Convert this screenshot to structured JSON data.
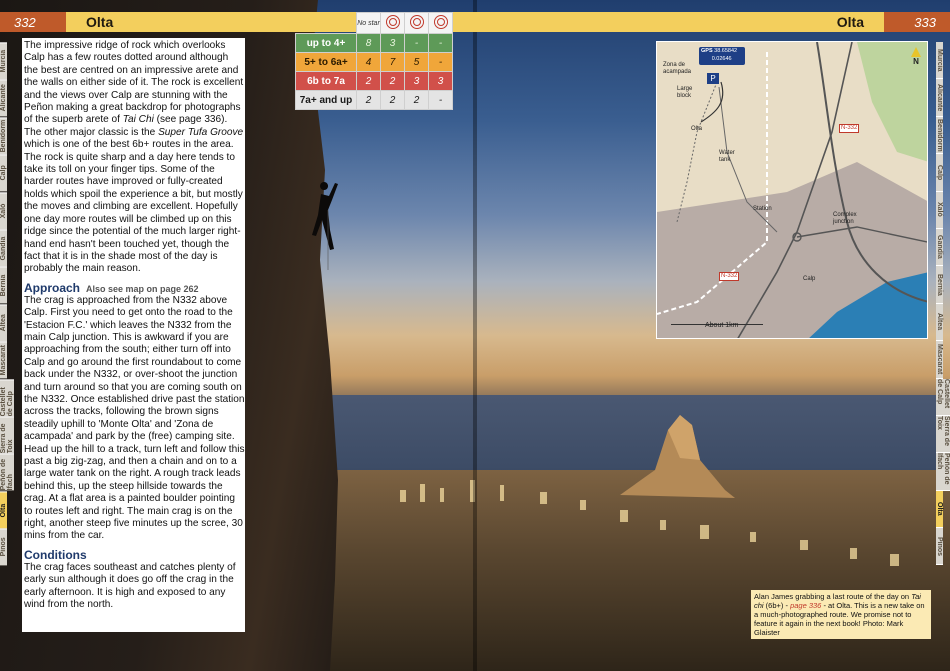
{
  "header": {
    "left_page_number": "332",
    "left_title": "Olta",
    "right_title": "Olta",
    "right_page_number": "333"
  },
  "grade_table": {
    "headers": [
      "No star"
    ],
    "star_icons": [
      "one-star-icon",
      "two-star-icon",
      "three-star-icon"
    ],
    "rows": [
      {
        "label": "up to 4+",
        "values": [
          "8",
          "3",
          "-",
          "-"
        ]
      },
      {
        "label": "5+ to 6a+",
        "values": [
          "4",
          "7",
          "5",
          "-"
        ]
      },
      {
        "label": "6b to 7a",
        "values": [
          "2",
          "2",
          "3",
          "3"
        ]
      },
      {
        "label": "7a+ and up",
        "values": [
          "2",
          "2",
          "2",
          "-"
        ]
      }
    ]
  },
  "tabs_left": [
    "Murcia",
    "Alicante",
    "Benidorm",
    "Calp",
    "Xaló",
    "Gandia",
    "Bernia",
    "Altea",
    "Mascarat",
    "Castellet de Calp",
    "Sierra de Toix",
    "Peñón de Ifach",
    "Olta",
    "Pinos"
  ],
  "tabs_right": [
    "Murcia",
    "Alicante",
    "Benidorm",
    "Calp",
    "Xaló",
    "Gandia",
    "Bernia",
    "Altea",
    "Mascarat",
    "Castellet de Calp",
    "Sierra de Toix",
    "Peñón de Ifach",
    "Olta",
    "Pinos"
  ],
  "active_tab": "Olta",
  "text": {
    "intro_1": "The impressive ridge of rock which overlooks Calp has a few routes dotted around although the best are centred on an impressive arete and the walls on either side of it. The rock is excellent and the views over Calp are stunning with the Peñon making a great backdrop for photographs of the superb arete of ",
    "intro_italic_1": "Tai Chi",
    "intro_2": " (see page 336). The other major classic is the ",
    "intro_italic_2": "Super Tufa Groove",
    "intro_3": " which is one of the best 6b+ routes in the area.",
    "para_2": "The rock is quite sharp and a day here tends to take its toll on your finger tips. Some of the harder routes have improved or fully-created holds which spoil the experience a bit, but mostly the moves and climbing are excellent. Hopefully one day more routes will be climbed up on this ridge since the potential of the much larger right-hand end hasn't been touched yet, though the fact that it is in the shade most of the day is probably the main reason.",
    "approach_heading": "Approach",
    "approach_aside": "Also see map on page 262",
    "approach_body": "The crag is approached from the N332 above Calp. First you need to get onto the road to the 'Estacion F.C.' which leaves the N332 from the main Calp junction. This is awkward if you are approaching from the south; either turn off into Calp and go around the first roundabout to come back under the N332, or over-shoot the junction and turn around so that you are coming south on the N332. Once established drive past the station across the tracks, following the brown signs steadily uphill to 'Monte Olta' and 'Zona de acampada' and park by the (free) camping site. Head up the hill to a track, turn left and follow this past a big zig-zag, and then a chain and on to a large water tank on the right. A rough track leads behind this, up the steep hillside towards the crag. At a flat area is a painted boulder pointing to routes left and right. The main crag is on the right, another steep five minutes up the scree, 30 mins from the car.",
    "conditions_heading": "Conditions",
    "conditions_body": "The crag faces southeast and catches plenty of early sun although it does go off the crag in the early afternoon. It is high and exposed to any wind from the north."
  },
  "map": {
    "gps_label": "GPS",
    "gps_lat": "38.65842",
    "gps_lon": "0.02646",
    "parking_symbol": "P",
    "north_label": "N",
    "labels": {
      "zona": "Zona de acampada",
      "large_block": "Large block",
      "olta": "Olta",
      "water_tank": "Water tank",
      "station": "Station",
      "complex_junction": "Complex junction",
      "calp": "Calp",
      "n332_top": "N-332",
      "n332_bottom": "N-332"
    },
    "scale_label": "About 1km",
    "colors": {
      "land": "#e8ddc6",
      "green": "#bed49e",
      "town": "#b8aca6",
      "sea": "#2b7fb5",
      "road": "#555555"
    }
  },
  "caption": {
    "text_1": "Alan James grabbing a last route of the day on ",
    "route_italic": "Tai chi",
    "text_2": " (6b+) - ",
    "page_ref": "page 336",
    "text_3": " - at Olta. This is a new take on a much-photographed route. We promise not to feature it again in the next book! Photo: Mark Glaister"
  }
}
